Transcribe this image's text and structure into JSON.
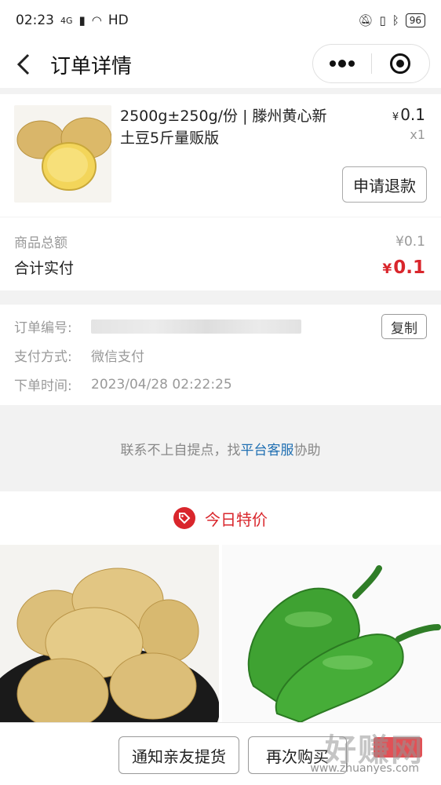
{
  "status_bar": {
    "time": "02:23",
    "network": "4G",
    "hd": "HD",
    "battery": "96"
  },
  "nav": {
    "title": "订单详情",
    "more_icon": "•••"
  },
  "product": {
    "name": "2500g±250g/份 | 滕州黄心新土豆5斤量贩版",
    "price_symbol": "¥",
    "price": "0.1",
    "quantity": "x1",
    "refund_label": "申请退款"
  },
  "summary": {
    "total_label": "商品总额",
    "total_value": "¥0.1",
    "paid_label": "合计实付",
    "paid_symbol": "¥",
    "paid_value": "0.1"
  },
  "order_info": {
    "order_no_label": "订单编号:",
    "copy_label": "复制",
    "pay_method_label": "支付方式:",
    "pay_method_value": "微信支付",
    "order_time_label": "下单时间:",
    "order_time_value": "2023/04/28 02:22:25"
  },
  "contact": {
    "prefix": "联系不上自提点，找",
    "link": "平台客服",
    "suffix": "协助"
  },
  "special": {
    "title": "今日特价"
  },
  "bottom": {
    "notify_label": "通知亲友提货",
    "rebuy_label": "再次购买"
  },
  "watermark": {
    "text": "好赚网",
    "url": "www.zhuanyes.com"
  },
  "colors": {
    "accent_red": "#d9262c",
    "link_blue": "#1f6fb2"
  }
}
